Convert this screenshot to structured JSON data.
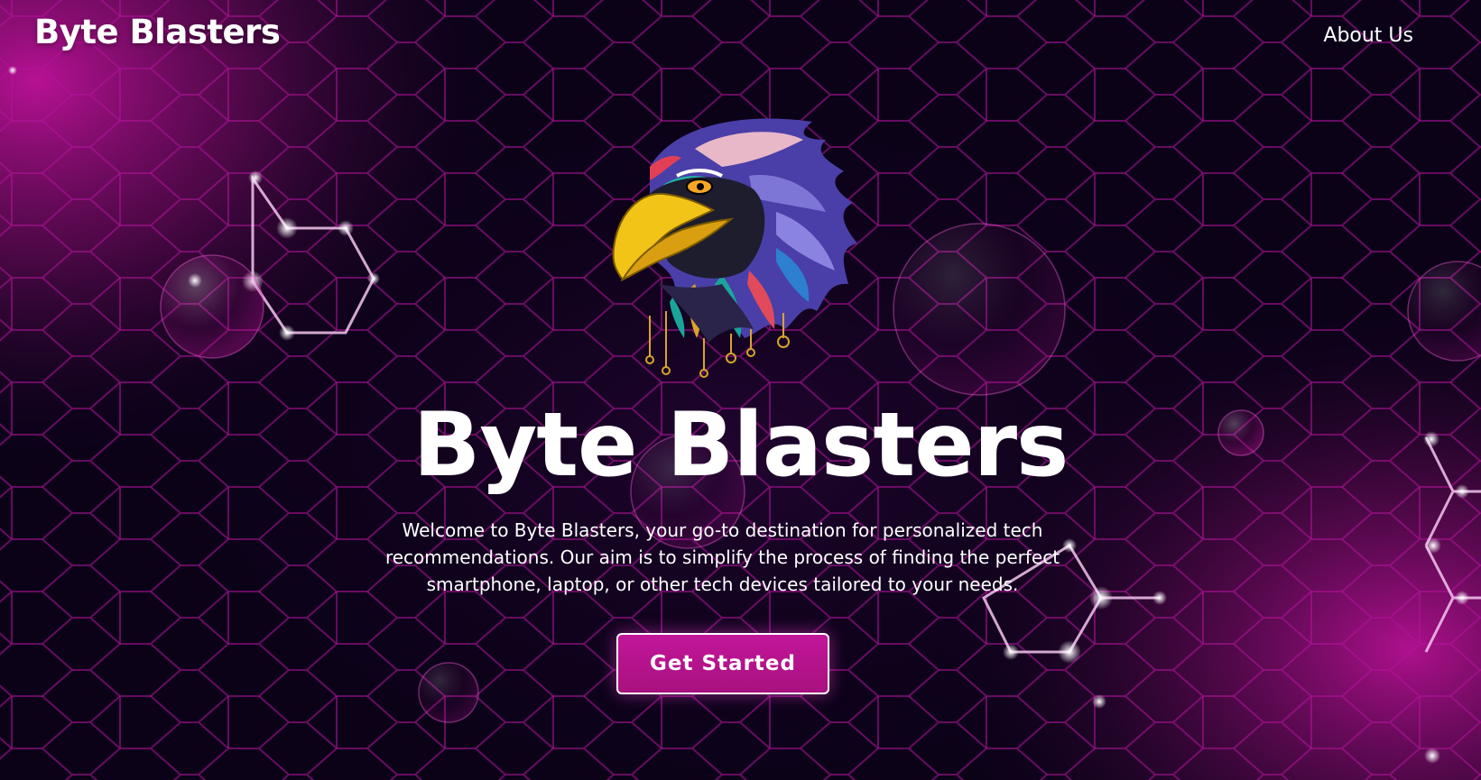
{
  "header": {
    "brand": "Byte Blasters",
    "nav": [
      {
        "label": "About Us"
      }
    ]
  },
  "hero": {
    "image_name": "eagle-logo",
    "title": "Byte Blasters",
    "description": "Welcome to Byte Blasters, your go-to destination for personalized tech recommendations. Our aim is to simplify the process of finding the perfect smartphone, laptop, or other tech devices tailored to your needs.",
    "cta_label": "Get Started"
  },
  "colors": {
    "background": "#0b0218",
    "accent": "#c2169a",
    "hex_glow": "#d41fb2",
    "text": "#ffffff"
  }
}
